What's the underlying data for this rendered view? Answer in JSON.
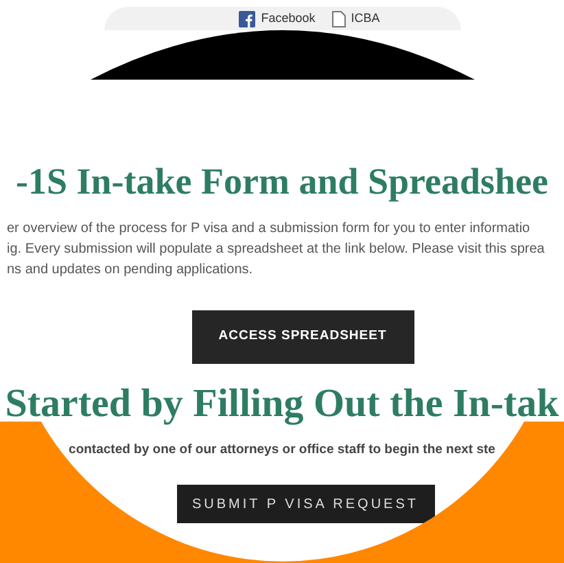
{
  "bookmarks": [
    {
      "label": "Facebook",
      "kind": "facebook"
    },
    {
      "label": "ICBA",
      "kind": "page"
    }
  ],
  "section_1": {
    "heading": "-1S In-take Form and Spreadshee",
    "lines": [
      "er overview of the process for P visa and a submission form for you to enter informatio",
      "ig. Every submission will populate a spreadsheet at the link below. Please visit this sprea",
      "ns and updates on pending applications."
    ],
    "button": "ACCESS SPREADSHEET"
  },
  "section_2": {
    "heading": "Started by Filling Out the In-tak",
    "text": "contacted by one of our attorneys or office staff to begin the next ste",
    "button": "SUBMIT P VISA REQUEST"
  }
}
